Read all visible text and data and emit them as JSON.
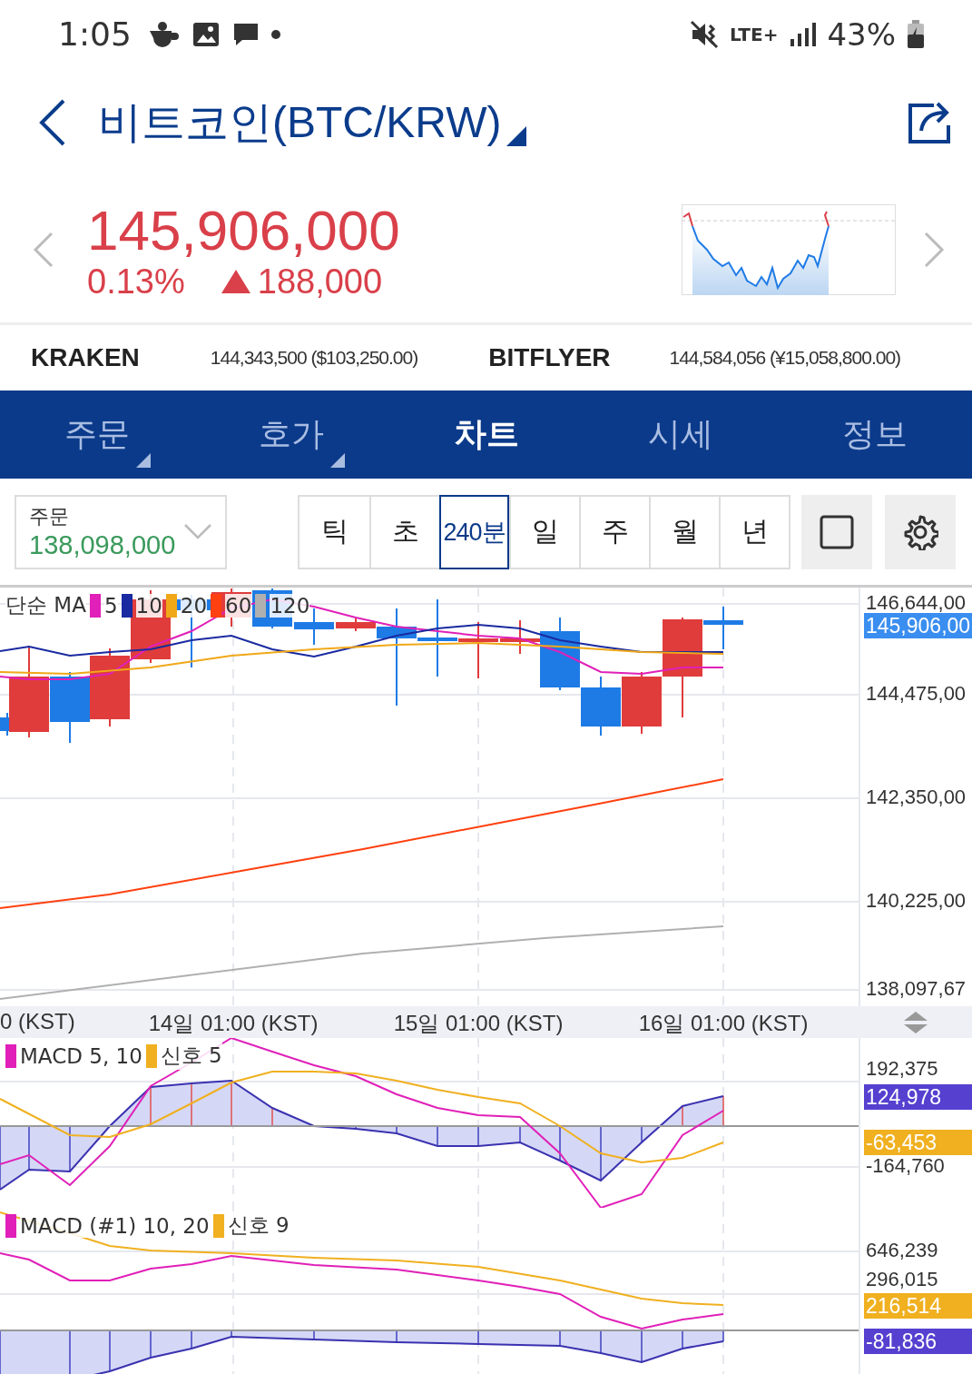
{
  "status_bar": {
    "time": "1:05",
    "network": "LTE+",
    "battery": "43%"
  },
  "header": {
    "title": "비트코인(BTC/KRW)"
  },
  "quote": {
    "price": "145,906,000",
    "change_percent": "0.13%",
    "change": "188,000"
  },
  "exchanges": [
    {
      "name": "KRAKEN",
      "price": "144,343,500 ($103,250.00)"
    },
    {
      "name": "BITFLYER",
      "price": "144,584,056 (¥15,058,800.00)"
    }
  ],
  "tabs": [
    {
      "label": "주문",
      "selected": false,
      "has_menu": true
    },
    {
      "label": "호가",
      "selected": false,
      "has_menu": true
    },
    {
      "label": "차트",
      "selected": true,
      "has_menu": false
    },
    {
      "label": "시세",
      "selected": false,
      "has_menu": false
    },
    {
      "label": "정보",
      "selected": false,
      "has_menu": false
    }
  ],
  "order_select": {
    "label": "주문",
    "value": "138,098,000"
  },
  "periods": [
    {
      "label": "틱",
      "selected": false
    },
    {
      "label": "초",
      "selected": false
    },
    {
      "label": "240분",
      "selected": true
    },
    {
      "label": "일",
      "selected": false
    },
    {
      "label": "주",
      "selected": false
    },
    {
      "label": "월",
      "selected": false
    },
    {
      "label": "년",
      "selected": false
    }
  ],
  "price_chart": {
    "legend_title": "단순 MA",
    "moving_averages": [
      {
        "label": "5",
        "color": "#e020b8"
      },
      {
        "label": "10",
        "color": "#1a2aa0"
      },
      {
        "label": "20",
        "color": "#f0a818"
      },
      {
        "label": "60",
        "color": "#ff4010"
      },
      {
        "label": "120",
        "color": "#b0b0b0"
      }
    ],
    "axis_labels": [
      "146,644,00",
      "144,475,00",
      "142,350,00",
      "140,225,00",
      "138,097,67"
    ],
    "current_price": "145,906,00"
  },
  "time_axis": [
    "0 (KST)",
    "14일 01:00 (KST)",
    "15일 01:00 (KST)",
    "16일 01:00 (KST)"
  ],
  "macd_panels": [
    {
      "legend": [
        {
          "label": "MACD 5, 10",
          "color": "#e020b8"
        },
        {
          "label": "신호 5",
          "color": "#f0b020"
        }
      ],
      "axis_labels": [
        "192,375",
        "-164,760"
      ],
      "badges": [
        {
          "text": "124,978",
          "color": "#5540d0"
        },
        {
          "text": "-63,453",
          "color": "#f0b020"
        }
      ]
    },
    {
      "legend": [
        {
          "label": "MACD (#1) 10, 20",
          "color": "#e020b8"
        },
        {
          "label": "신호 9",
          "color": "#f0b020"
        }
      ],
      "axis_labels": [
        "646,239",
        "296,015"
      ],
      "badges": [
        {
          "text": "216,514",
          "color": "#f0b020"
        },
        {
          "text": "-81,836",
          "color": "#5540d0"
        }
      ]
    }
  ]
}
